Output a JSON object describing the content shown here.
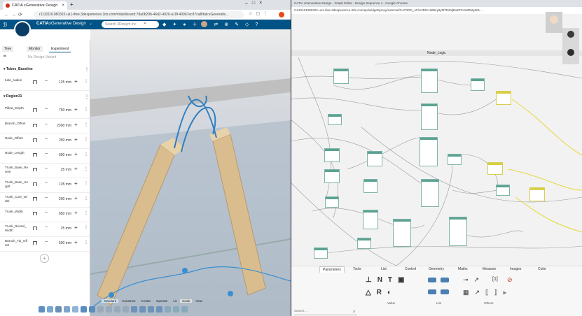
{
  "left_browser": {
    "tab_title": "CATIA xGenerative Design",
    "url": "r1132101080322-us1-ifwe.3dexperience.3ds.com/#dashboard:78a0b29b-46d2-4029-a19f-40967ec97ca8/tab:xGenerativ...",
    "app_name": "CATIA",
    "app_product": "xGenerative Design",
    "search_placeholder": "Search 3Dswym Inc",
    "panel_tabs": [
      "Tree",
      "Monitor",
      "Experiment"
    ],
    "no_variants": "No Design Variant",
    "sections": [
      {
        "title": "Tubes_Baseline"
      },
      {
        "title": "Region31"
      }
    ],
    "params": [
      {
        "label": "tube_radius",
        "value": "125 mm"
      },
      {
        "label": "Pillow_Depth",
        "value": "750 mm"
      },
      {
        "label": "Branch_Offset",
        "value": "2300 mm"
      },
      {
        "label": "Node_Offset",
        "value": "250 mm"
      },
      {
        "label": "Node_Length",
        "value": "600 mm"
      },
      {
        "label": "Trunk_Base_Re vest",
        "value": "25 mm"
      },
      {
        "label": "Trunk_Base_He ight",
        "value": "135 mm"
      },
      {
        "label": "Trunk_Core_Wi dth",
        "value": "200 mm"
      },
      {
        "label": "Trunk_Width",
        "value": "650 mm"
      },
      {
        "label": "Trunk_Revsel_ Width",
        "value": "25 mm"
      },
      {
        "label": "Branch_Tip_Off set",
        "value": "500 mm"
      }
    ],
    "toolbar_tabs": [
      "Standard",
      "Construct",
      "Create",
      "Operate",
      "Lit",
      "Scale",
      "View"
    ]
  },
  "right_browser": {
    "title": "CATIA xGenerative Design - Graph Editor - Design Sequence 1 - Google Chrome",
    "url": "r1132101080322-us1-ifwe.3dexperience.3ds.com/api/widget/proxy/external/CAT3GD_AF/xHR0cHM6Ly9yMTEzMjEwMTA4MDMyMi1...",
    "graph_title": "Node_Logic",
    "bottom_tabs": [
      "Parameters",
      "Tools",
      "List",
      "Control",
      "Geometry",
      "Maths",
      "Measure",
      "Images",
      "Color"
    ],
    "groups": [
      "Value",
      "List",
      "Others"
    ],
    "search_placeholder": "Search...",
    "list_glyph": "[1]"
  },
  "colors": {
    "accent": "#005386",
    "node_border": "#5ba292",
    "highlight": "#e5d93b",
    "beam": "#d9bd8f"
  }
}
